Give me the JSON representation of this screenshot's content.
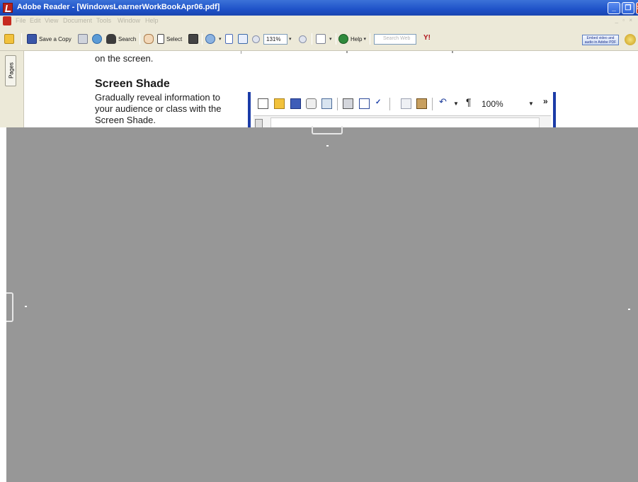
{
  "window": {
    "title": "Adobe Reader - [WindowsLearnerWorkBookApr06.pdf]",
    "min_label": "_",
    "max_label": "❐",
    "close_label": "×"
  },
  "menu": {
    "items": [
      "File",
      "Edit",
      "View",
      "Document",
      "Tools",
      "Window",
      "Help"
    ],
    "mdi_controls": "_ ▫ ×"
  },
  "toolbar": {
    "save_copy": "Save a Copy",
    "search": "Search",
    "select": "Select",
    "zoom_value": "131%",
    "help": "Help",
    "search_web_placeholder": "Search Web",
    "yahoo": "Y!",
    "promo_line1": "Embed video and",
    "promo_line2": "audio in Adobe PDF"
  },
  "nav": {
    "pages_tab": "Pages"
  },
  "document": {
    "prev_text": "on the screen.",
    "heading": "Screen Shade",
    "body_lines": [
      "Gradually reveal information to",
      "your audience or class with the",
      "Screen Shade."
    ],
    "embedded_toolbar": {
      "zoom_value": "100%",
      "more": "»"
    }
  },
  "colors": {
    "titlebar": "#1f52c8",
    "shade": "#979797",
    "chrome": "#ece9d8",
    "embed_border": "#1c3ca8"
  }
}
